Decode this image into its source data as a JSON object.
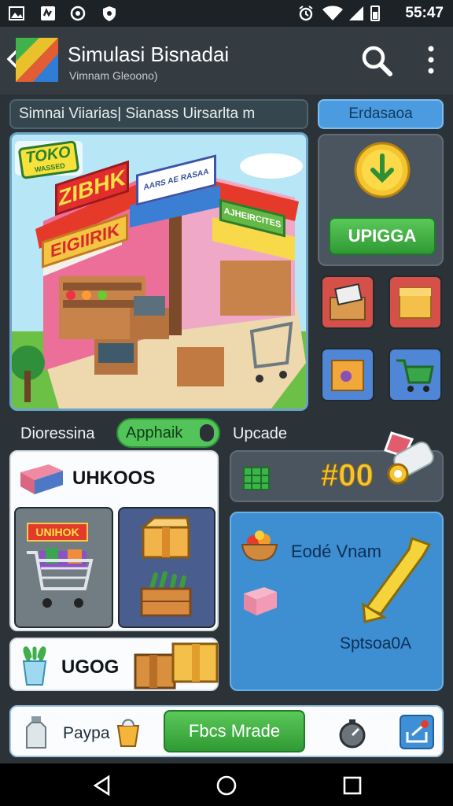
{
  "status_bar": {
    "time": "55:47"
  },
  "app_bar": {
    "title": "Simulasi Bisnadai",
    "subtitle": "Vimnam Gleoono)"
  },
  "banner": {
    "text": "Simnai Viiarias| Sianass Uirsarlta m"
  },
  "side_button": {
    "label": "Erdasaoa"
  },
  "shop_scene": {
    "toko_sign": "TOKO",
    "toko_sub": "WASSED",
    "sign_a": "ZIBHK",
    "sign_b": "EIGIIRIK",
    "sign_c": "AARS AE RASAA",
    "sign_d": "AJHEIRCITES"
  },
  "upgrade_button": {
    "label": "UPIGGA"
  },
  "section": {
    "left_label": "Dioressina",
    "pill_label": "Apphaik",
    "right_label": "Upcade"
  },
  "score": {
    "value": "#00"
  },
  "inventory": {
    "title": "UHKOOS",
    "cart_sign": "UNIHOK"
  },
  "blue_panel": {
    "title": "Eodé Vnam",
    "sub": "Sptsoa0A"
  },
  "goods": {
    "label": "UGOG"
  },
  "bottom_bar": {
    "left_label": "Paypa",
    "button_label": "Fbcs Mrade"
  },
  "colors": {
    "accent_green": "#3aa83d",
    "panel_blue": "#3d8fd1",
    "dark_bg": "#2c3338"
  }
}
